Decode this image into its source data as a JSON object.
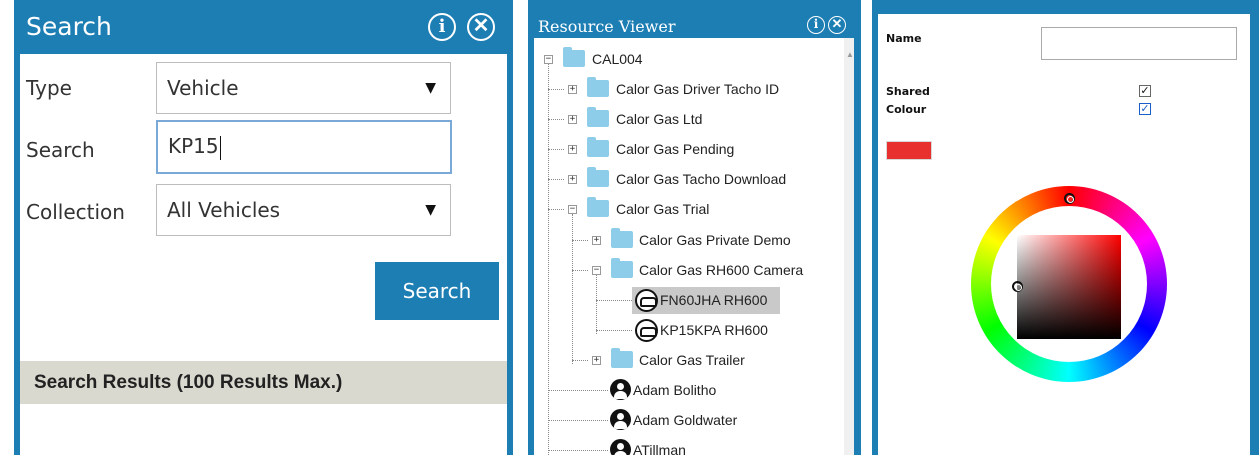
{
  "search_panel": {
    "title": "Search",
    "info_icon": "info-circle-icon",
    "close_icon": "close-circle-icon",
    "type_label": "Type",
    "type_value": "Vehicle",
    "search_label": "Search",
    "search_value": "KP15",
    "collection_label": "Collection",
    "collection_value": "All Vehicles",
    "search_button": "Search",
    "results_header": "Search Results (100 Results Max.)",
    "accent_color": "#1d7eb4"
  },
  "resource_viewer": {
    "title": "Resource Viewer",
    "nodes": {
      "root": "CAL004",
      "driver_tacho": "Calor Gas Driver Tacho ID",
      "ltd": "Calor Gas Ltd",
      "pending": "Calor Gas Pending",
      "tacho_download": "Calor Gas Tacho Download",
      "trial": "Calor Gas Trial",
      "private_demo": "Calor Gas Private Demo",
      "rh600_camera": "Calor Gas RH600 Camera",
      "vehicle_1": "FN60JHA RH600",
      "vehicle_2": "KP15KPA RH600",
      "trailer": "Calor Gas Trailer",
      "person_1": "Adam Bolitho",
      "person_2": "Adam Goldwater",
      "person_3": "ATillman"
    },
    "selected_node": "FN60JHA RH600"
  },
  "colour_panel": {
    "name_label": "Name",
    "name_value": "",
    "shared_label": "Shared",
    "shared_checked": true,
    "colour_label": "Colour",
    "colour_checked": true,
    "swatch_color": "#e8312f"
  }
}
